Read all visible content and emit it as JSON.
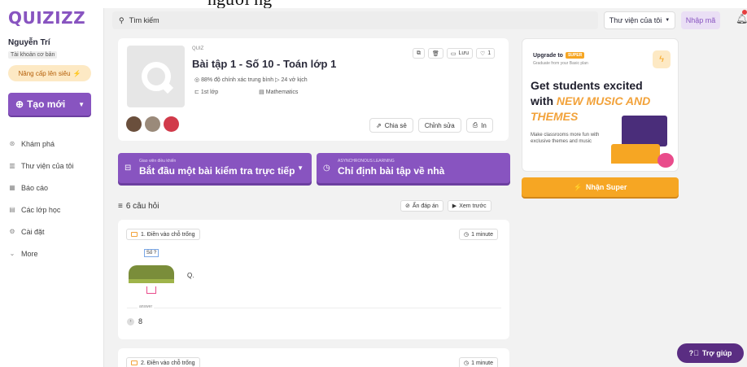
{
  "overlay_text": "ngươi ng",
  "brand": {
    "logo": "QUIZIZZ"
  },
  "user": {
    "name": "Nguyễn Trí",
    "plan": "Tài khoản cơ bản",
    "upgrade_label": "Nâng cấp lên siêu"
  },
  "create_button": {
    "label": "Tạo mới"
  },
  "nav": [
    {
      "label": "Khám phá",
      "icon": "compass-icon"
    },
    {
      "label": "Thư viện của tôi",
      "icon": "library-icon"
    },
    {
      "label": "Báo cáo",
      "icon": "report-icon"
    },
    {
      "label": "Các lớp học",
      "icon": "classes-icon"
    },
    {
      "label": "Cài đặt",
      "icon": "gear-icon"
    },
    {
      "label": "More",
      "icon": "chevron-down-icon"
    }
  ],
  "topbar": {
    "search_placeholder": "Tìm kiếm",
    "library_select": "Thư viện của tôi",
    "code_button": "Nhập mã"
  },
  "quiz": {
    "type": "QUIZ",
    "title": "Bài tập 1 - Số 10 - Toán lớp 1",
    "accuracy": "88% độ chính xác trung bình",
    "plays": "24 vở kịch",
    "grade": "1st lớp",
    "subject": "Mathematics",
    "save_label": "Lưu",
    "likes": "1",
    "share_label": "Chia sẻ",
    "edit_label": "Chỉnh sửa",
    "print_label": "In"
  },
  "actions": {
    "live": {
      "small": "Giao viên điều khiển",
      "main": "Bắt đầu một bài kiểm tra trực tiếp"
    },
    "homework": {
      "small": "ASYNCHRONOUS LEARNING",
      "main": "Chỉ định bài tập về nhà"
    }
  },
  "questions_header": {
    "count": "6 câu hỏi",
    "hide_answers": "Ẩn đáp án",
    "preview": "Xem trước"
  },
  "questions": [
    {
      "type": "1. Điền vào chỗ trống",
      "time": "1 minute",
      "image_label": "Số ?",
      "text": "Q.",
      "answer_label": "answer",
      "answer": "8"
    },
    {
      "type": "2. Điền vào chỗ trống",
      "time": "1 minute"
    }
  ],
  "promo": {
    "upgrade_to": "Upgrade to",
    "super_tag": "SUPER",
    "graduate": "Graduate from your Basic plan",
    "head1": "Get students excited",
    "head2_prefix": "with ",
    "head2_accent": "NEW MUSIC AND",
    "head3": "THEMES",
    "desc": "Make classrooms more fun with exclusive themes and music"
  },
  "super_button": "Nhận Super",
  "help_button": "Trợ giúp",
  "colors": {
    "primary": "#8854c0",
    "accent": "#f6a623",
    "help": "#5a2d82"
  }
}
